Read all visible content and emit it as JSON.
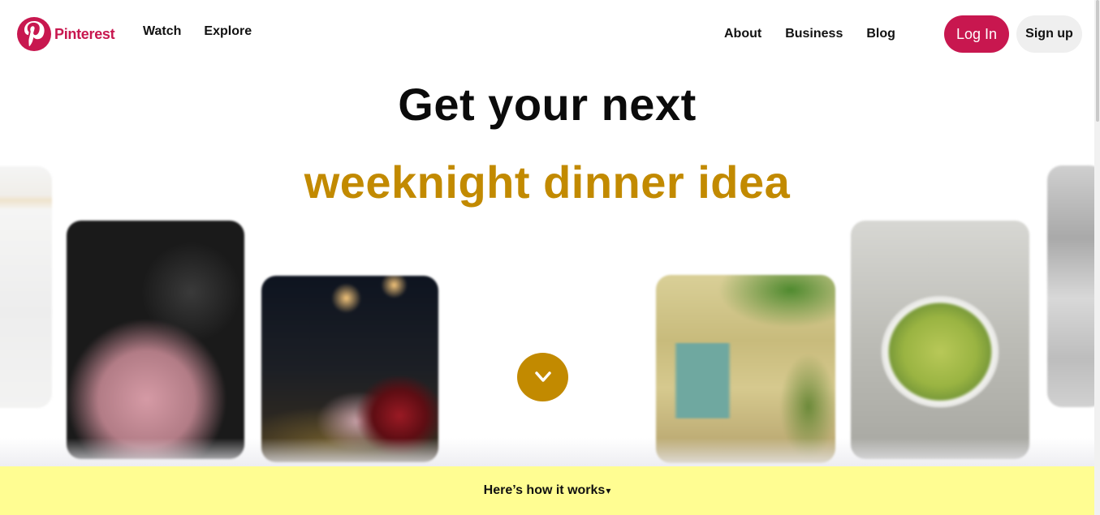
{
  "colors": {
    "brand": "#c8174f",
    "accent": "#c28a00",
    "banner": "#fffd92"
  },
  "header": {
    "logo_text": "Pinterest",
    "logo_icon": "pinterest-p-icon",
    "nav_left": [
      "Watch",
      "Explore"
    ],
    "nav_right": [
      "About",
      "Business",
      "Blog"
    ],
    "login_label": "Log In",
    "signup_label": "Sign up"
  },
  "hero": {
    "title": "Get your next",
    "subtitle": "weeknight dinner idea",
    "scroll_icon": "chevron-down-icon"
  },
  "tiles": [
    {
      "name": "tile-white-partial"
    },
    {
      "name": "tile-pink-flowers"
    },
    {
      "name": "tile-night-street-roses"
    },
    {
      "name": "tile-stone-cottage-door"
    },
    {
      "name": "tile-bowl-of-pears"
    },
    {
      "name": "tile-gray-partial"
    }
  ],
  "banner": {
    "text": "Here’s how it works",
    "arrow": "▾"
  }
}
